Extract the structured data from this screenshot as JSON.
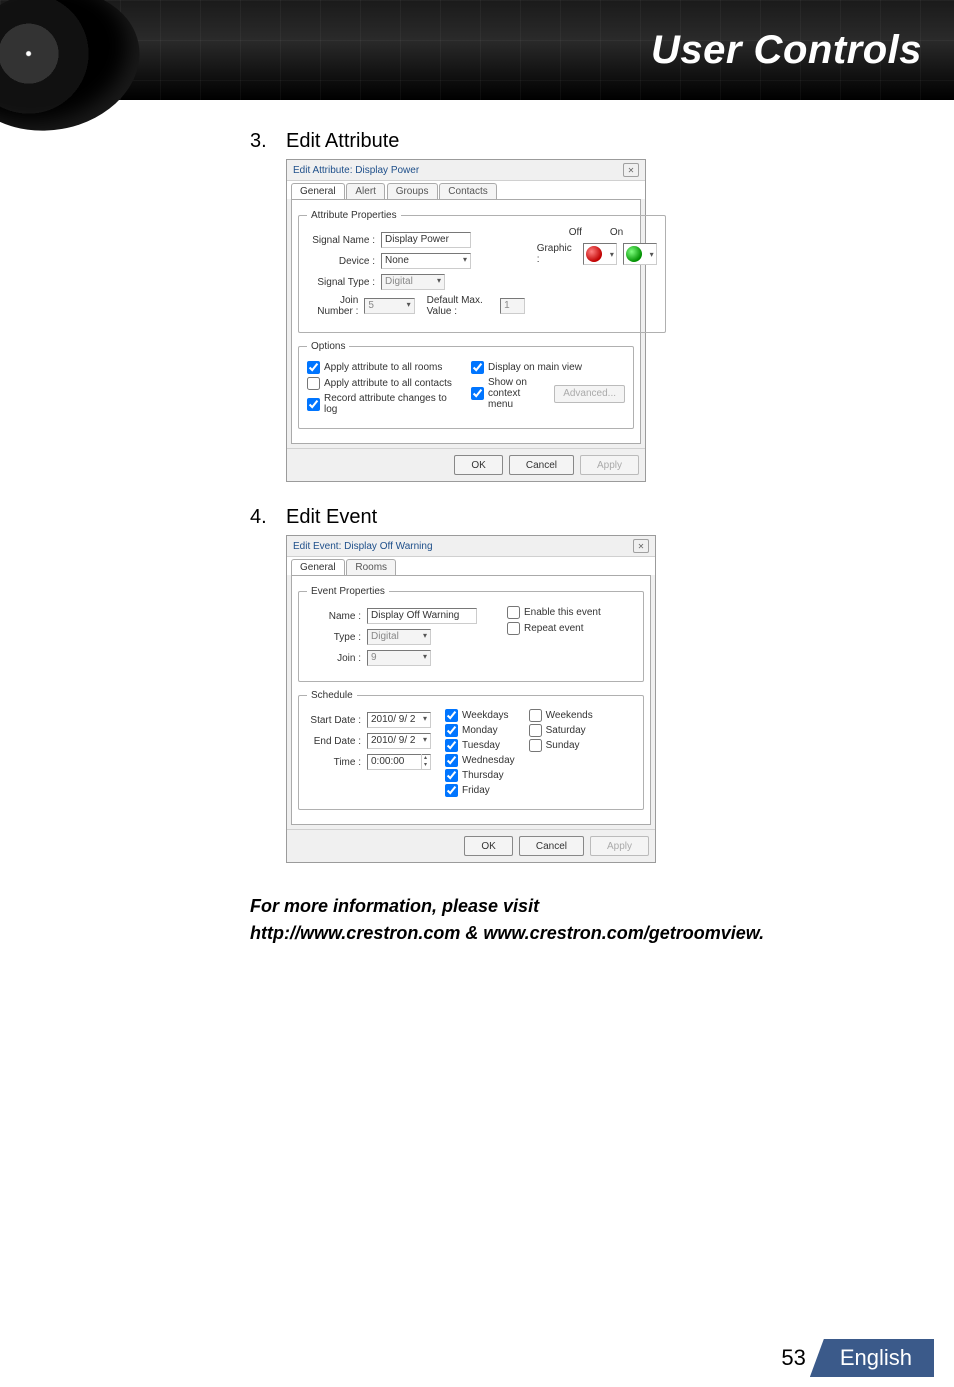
{
  "header": {
    "title": "User Controls"
  },
  "items": {
    "i3": {
      "num": "3.",
      "heading": "Edit Attribute"
    },
    "i4": {
      "num": "4.",
      "heading": "Edit Event"
    }
  },
  "dlg_attr": {
    "title": "Edit Attribute: Display Power",
    "tabs": {
      "general": "General",
      "alert": "Alert",
      "groups": "Groups",
      "contacts": "Contacts"
    },
    "group_props": "Attribute Properties",
    "off": "Off",
    "on": "On",
    "signal_name_lbl": "Signal Name :",
    "signal_name_val": "Display Power",
    "graphic_lbl": "Graphic :",
    "device_lbl": "Device :",
    "device_val": "None",
    "signal_type_lbl": "Signal Type :",
    "signal_type_val": "Digital",
    "join_lbl": "Join Number :",
    "join_val": "5",
    "default_max_lbl": "Default Max. Value :",
    "default_max_val": "1",
    "group_opts": "Options",
    "opt_all_rooms": "Apply attribute to all rooms",
    "opt_all_contacts": "Apply attribute to all contacts",
    "opt_record_log": "Record attribute changes to log",
    "opt_display_main": "Display on main view",
    "opt_context_menu": "Show on context menu",
    "btn_advanced": "Advanced...",
    "btn_ok": "OK",
    "btn_cancel": "Cancel",
    "btn_apply": "Apply"
  },
  "dlg_event": {
    "title": "Edit Event: Display Off Warning",
    "tabs": {
      "general": "General",
      "rooms": "Rooms"
    },
    "group_props": "Event Properties",
    "name_lbl": "Name :",
    "name_val": "Display Off Warning",
    "type_lbl": "Type :",
    "type_val": "Digital",
    "join_lbl": "Join :",
    "join_val": "9",
    "enable_event": "Enable this event",
    "repeat_event": "Repeat event",
    "group_sched": "Schedule",
    "start_lbl": "Start Date :",
    "start_val": "2010/ 9/ 2",
    "end_lbl": "End Date :",
    "end_val": "2010/ 9/ 2",
    "time_lbl": "Time :",
    "time_val": "0:00:00",
    "weekdays": "Weekdays",
    "weekends": "Weekends",
    "mon": "Monday",
    "tue": "Tuesday",
    "wed": "Wednesday",
    "thu": "Thursday",
    "fri": "Friday",
    "sat": "Saturday",
    "sun": "Sunday",
    "btn_ok": "OK",
    "btn_cancel": "Cancel",
    "btn_apply": "Apply"
  },
  "footer_note": {
    "line1": "For more information, please visit",
    "line2": "http://www.crestron.com & www.crestron.com/getroomview."
  },
  "page": {
    "num": "53",
    "lang": "English"
  }
}
